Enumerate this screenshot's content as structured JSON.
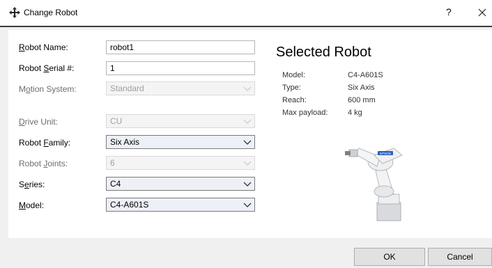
{
  "window": {
    "title": "Change Robot",
    "help": "?",
    "title_icon": "move-arrows-icon",
    "close_icon": "close-icon"
  },
  "form": {
    "robot_name": {
      "label_pre": "",
      "label_ul": "R",
      "label_post": "obot Name:",
      "value": "robot1"
    },
    "serial": {
      "label_pre": "Robot ",
      "label_ul": "S",
      "label_post": "erial #:",
      "value": "1"
    },
    "motion": {
      "label_pre": "M",
      "label_ul": "o",
      "label_post": "tion System:",
      "value": "Standard"
    },
    "drive": {
      "label_pre": "",
      "label_ul": "D",
      "label_post": "rive Unit:",
      "value": "CU"
    },
    "family": {
      "label_pre": "Robot ",
      "label_ul": "F",
      "label_post": "amily:",
      "value": "Six Axis"
    },
    "joints": {
      "label_pre": "Robot ",
      "label_ul": "J",
      "label_post": "oints:",
      "value": "6"
    },
    "series": {
      "label_pre": "S",
      "label_ul": "e",
      "label_post": "ries:",
      "value": "C4"
    },
    "model": {
      "label_pre": "",
      "label_ul": "M",
      "label_post": "odel:",
      "value": "C4-A601S"
    }
  },
  "selected": {
    "title": "Selected Robot",
    "model_label": "Model:",
    "model_value": "C4-A601S",
    "type_label": "Type:",
    "type_value": "Six Axis",
    "reach_label": "Reach:",
    "reach_value": "600  mm",
    "payload_label": "Max payload:",
    "payload_value": "4  kg",
    "robot_logo": "EPSON"
  },
  "buttons": {
    "ok": "OK",
    "cancel": "Cancel"
  },
  "colors": {
    "accent_line": "#3c3c3c",
    "active_select": "#eef0f7",
    "button": "#e1e1e1"
  }
}
